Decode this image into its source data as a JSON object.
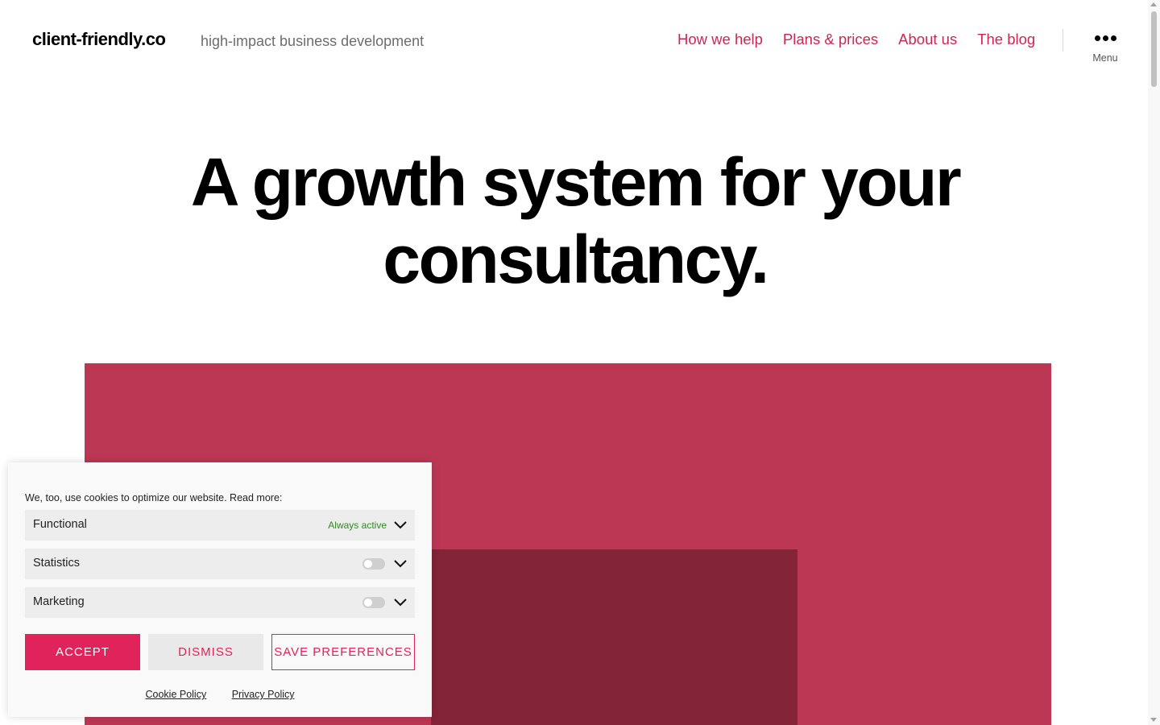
{
  "header": {
    "site_title": "client-friendly.co",
    "tagline": "high-impact business development",
    "nav": [
      {
        "label": "How we help"
      },
      {
        "label": "Plans & prices"
      },
      {
        "label": "About us"
      },
      {
        "label": "The blog"
      }
    ],
    "menu_label": "Menu",
    "menu_icon": "more-dots-icon",
    "link_color": "#cd2653"
  },
  "hero": {
    "title_line1": "A growth system for your",
    "title_line2": "consultancy.",
    "block_color": "#bc3754",
    "inner_color": "#832438"
  },
  "cookie_banner": {
    "message": "We, too, use cookies to optimize our website. Read more:",
    "categories": [
      {
        "name": "Functional",
        "status": "Always active",
        "enabled": true
      },
      {
        "name": "Statistics",
        "enabled": false
      },
      {
        "name": "Marketing",
        "enabled": false
      }
    ],
    "buttons": {
      "accept": "ACCEPT",
      "dismiss": "DISMISS",
      "save": "SAVE PREFERENCES"
    },
    "links": {
      "cookie_policy": "Cookie Policy",
      "privacy_policy": "Privacy Policy"
    },
    "accent_color": "#e0245b",
    "status_color": "#2d8a1f"
  }
}
